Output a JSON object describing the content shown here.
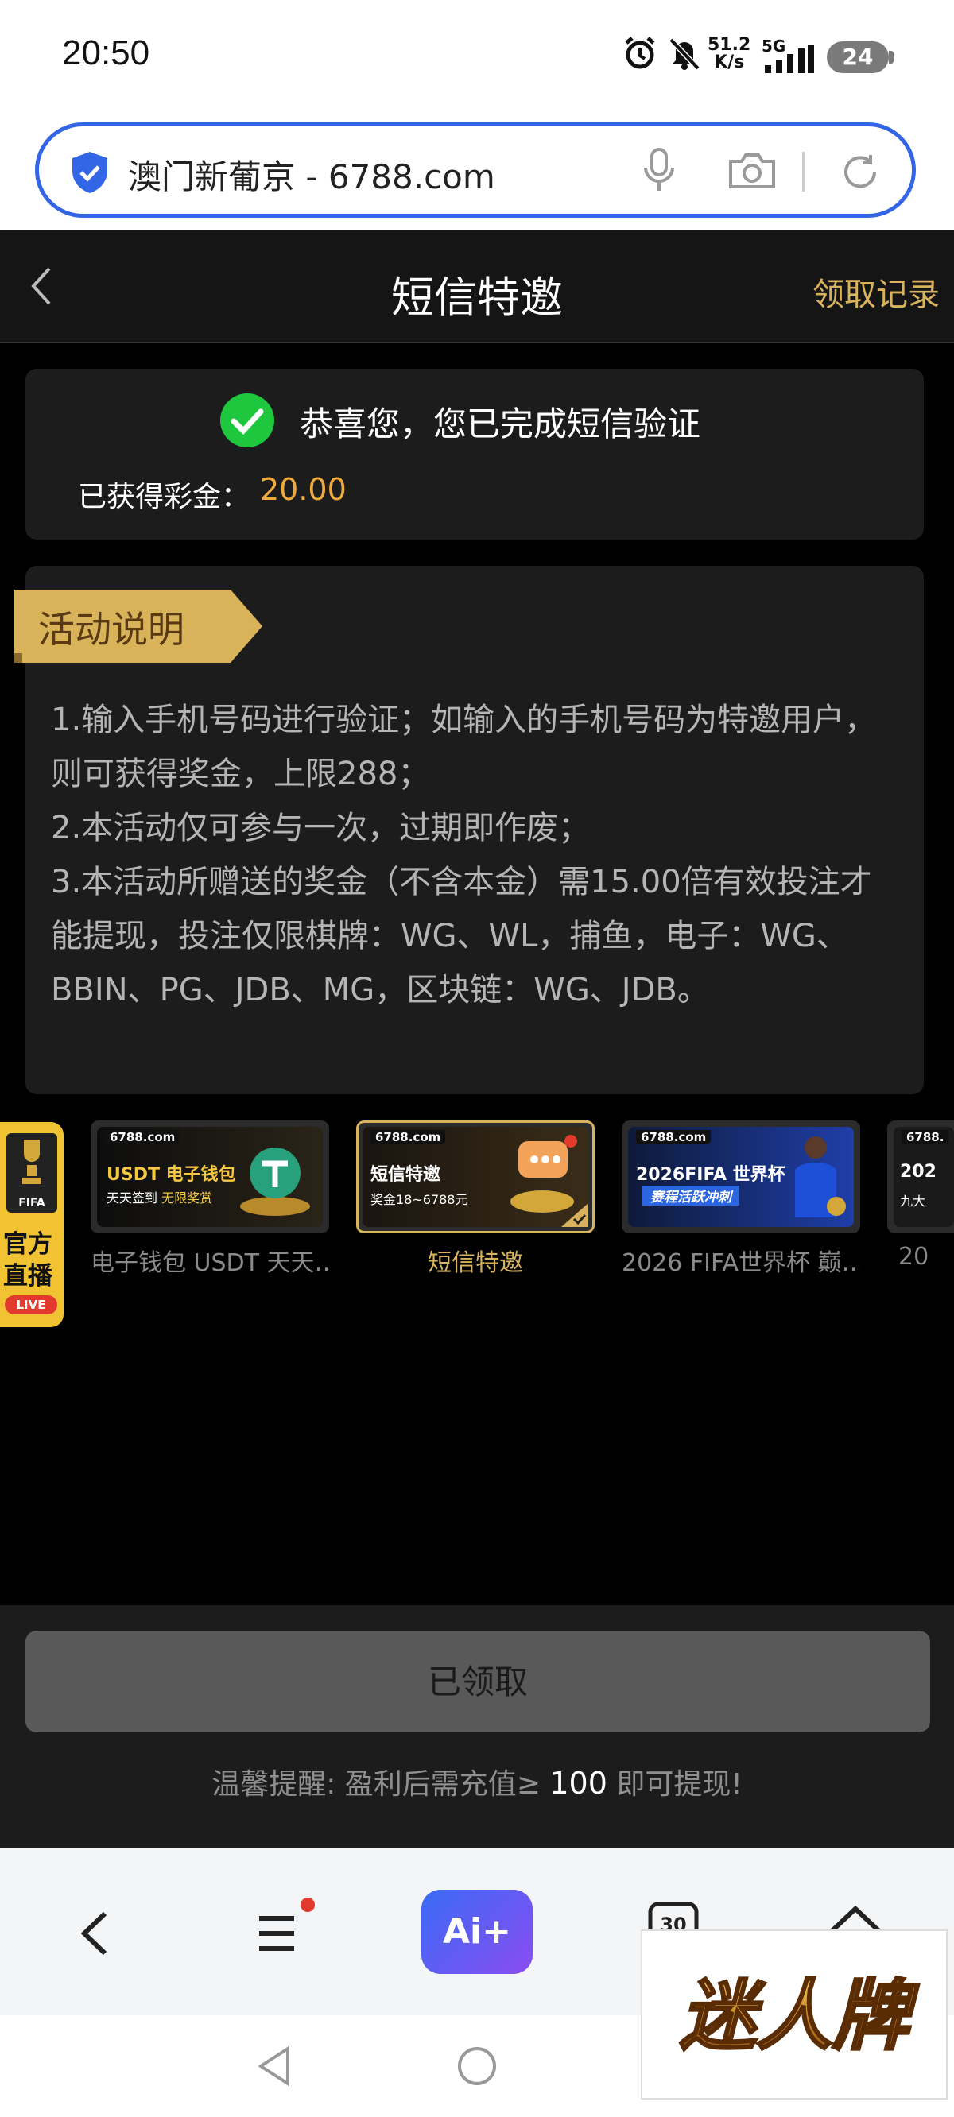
{
  "status_bar": {
    "time": "20:50",
    "net_speed_value": "51.2",
    "net_speed_unit": "K/s",
    "network": "5G",
    "battery": "24"
  },
  "url_bar": {
    "url_text": "澳门新葡京 - 6788.com"
  },
  "header": {
    "title": "短信特邀",
    "history_link": "领取记录"
  },
  "success_card": {
    "message": "恭喜您，您已完成短信验证",
    "bonus_label": "已获得彩金：",
    "bonus_value": "20.00"
  },
  "description": {
    "tag": "活动说明",
    "lines": [
      "1.输入手机号码进行验证；如输入的手机号码为特邀用户，则可获得奖金，上限288；",
      "2.本活动仅可参与一次，过期即作废；",
      "3.本活动所赠送的奖金（不含本金）需15.00倍有效投注才能提现，投注仅限棋牌：WG、WL，捕鱼，电子：WG、BBIN、PG、JDB、MG，区块链：WG、JDB。"
    ]
  },
  "live_badge": {
    "fifa": "FIFA",
    "line1": "官方",
    "line2": "直播",
    "live": "LIVE"
  },
  "promos": [
    {
      "brand": "6788.com",
      "banner_title": "USDT 电子钱包",
      "banner_sub": "天天签到",
      "banner_sub_highlight": "无限奖赏",
      "caption": "电子钱包 USDT 天天…",
      "active": false
    },
    {
      "brand": "6788.com",
      "banner_title": "短信特邀",
      "banner_sub": "奖金18~6788元",
      "caption": "短信特邀",
      "active": true
    },
    {
      "brand": "6788.com",
      "banner_title": "2026FIFA 世界杯",
      "banner_sub": "赛程活跃冲刺",
      "caption": "2026 FIFA世界杯 巅…",
      "active": false
    },
    {
      "brand": "6788.",
      "banner_title": "202",
      "banner_sub": "九大",
      "caption": "20",
      "active": false
    }
  ],
  "bottom": {
    "claimed_button": "已领取",
    "tip_prefix": "温馨提醒: 盈利后需充值≥ ",
    "tip_amount": "100",
    "tip_suffix": " 即可提现!"
  },
  "browser_nav": {
    "ai_label": "Ai+",
    "tabs_count": "30"
  },
  "watermark": {
    "text": "迷人牌"
  },
  "colors": {
    "accent_gold": "#d8b25c",
    "bonus_orange": "#f0a93b",
    "success_green": "#1ec73e",
    "url_border_blue": "#3366e6"
  }
}
